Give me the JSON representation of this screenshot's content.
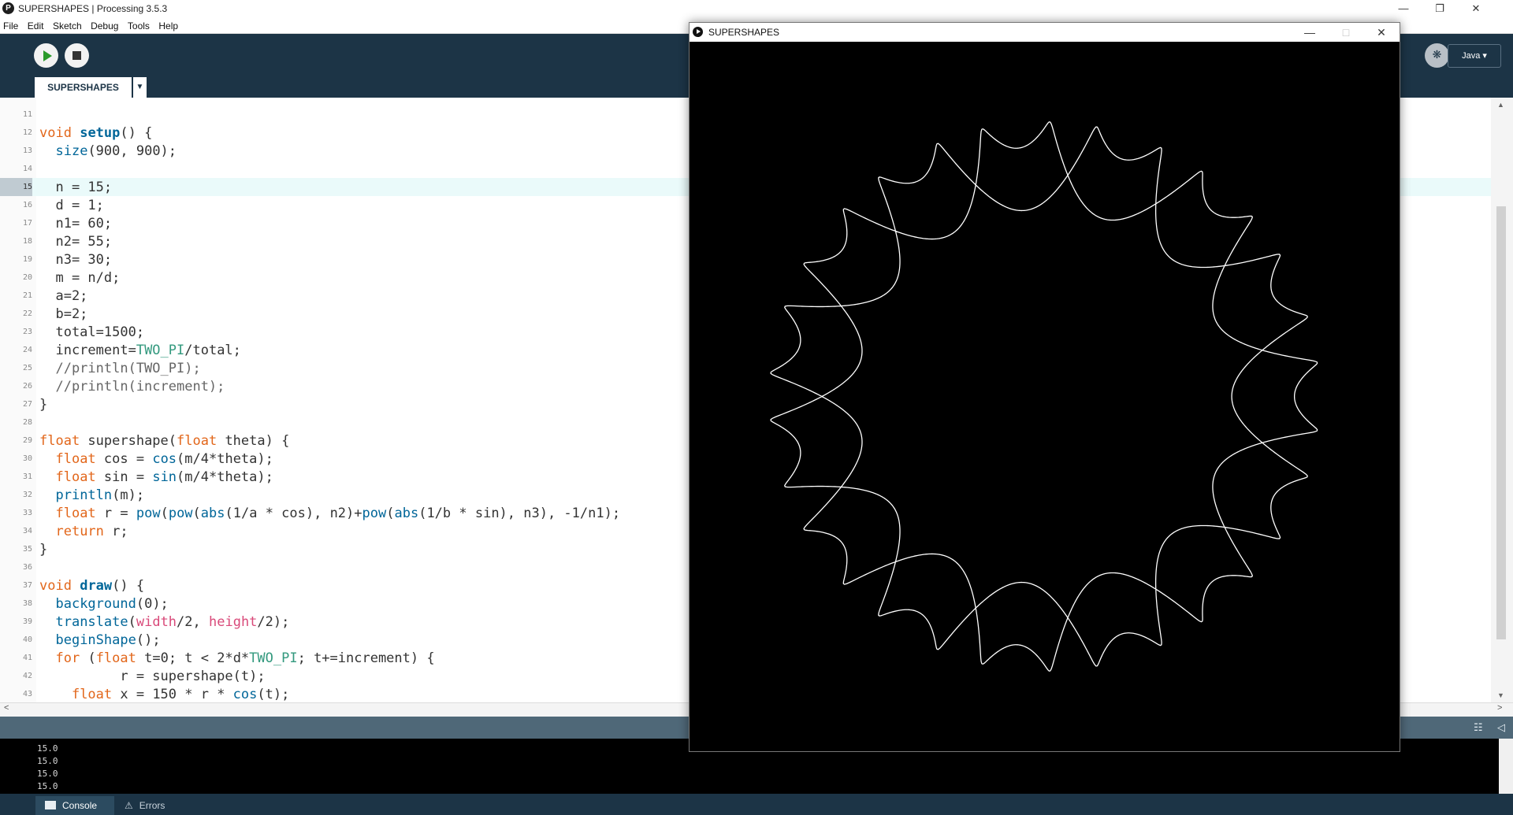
{
  "window": {
    "title": "SUPERSHAPES | Processing 3.5.3",
    "app_icon": "processing-logo-icon",
    "controls": [
      "minimize-icon",
      "restore-icon",
      "close-icon"
    ]
  },
  "menu": [
    "File",
    "Edit",
    "Sketch",
    "Debug",
    "Tools",
    "Help"
  ],
  "toolbar": {
    "run_icon": "play-icon",
    "stop_icon": "stop-icon",
    "debug_icon": "debugger-icon",
    "mode_label": "Java ▾"
  },
  "tab": {
    "label": "SUPERSHAPES",
    "menu_glyph": "▼"
  },
  "editor": {
    "current_line": 15,
    "lines": [
      {
        "n": "11"
      },
      {
        "n": "12"
      },
      {
        "n": "13"
      },
      {
        "n": "14"
      },
      {
        "n": "15"
      },
      {
        "n": "16"
      },
      {
        "n": "17"
      },
      {
        "n": "18"
      },
      {
        "n": "19"
      },
      {
        "n": "20"
      },
      {
        "n": "21"
      },
      {
        "n": "22"
      },
      {
        "n": "23"
      },
      {
        "n": "24"
      },
      {
        "n": "25"
      },
      {
        "n": "26"
      },
      {
        "n": "27"
      },
      {
        "n": "28"
      },
      {
        "n": "29"
      },
      {
        "n": "30"
      },
      {
        "n": "31"
      },
      {
        "n": "32"
      },
      {
        "n": "33"
      },
      {
        "n": "34"
      },
      {
        "n": "35"
      },
      {
        "n": "36"
      },
      {
        "n": "37"
      },
      {
        "n": "38"
      },
      {
        "n": "39"
      },
      {
        "n": "40"
      },
      {
        "n": "41"
      },
      {
        "n": "42"
      },
      {
        "n": "43"
      }
    ],
    "code": [
      "",
      "void setup() {",
      "  size(900, 900);",
      "",
      "  n = 15;",
      "  d = 1;",
      "  n1= 60;",
      "  n2= 55;",
      "  n3= 30;",
      "  m = n/d;",
      "  a=2;",
      "  b=2;",
      "  total=1500;",
      "  increment=TWO_PI/total;",
      "  //println(TWO_PI);",
      "  //println(increment);",
      "}",
      "",
      "float supershape(float theta) {",
      "  float cos = cos(m/4*theta);",
      "  float sin = sin(m/4*theta);",
      "  println(m);",
      "  float r = pow(pow(abs(1/a * cos), n2)+pow(abs(1/b * sin), n3), -1/n1);",
      "  return r;",
      "}",
      "",
      "void draw() {",
      "  background(0);",
      "  translate(width/2, height/2);",
      "  beginShape();",
      "  for (float t=0; t < 2*d*TWO_PI; t+=increment) {",
      "          r = supershape(t);",
      "    float x = 150 * r * cos(t);"
    ]
  },
  "console": {
    "lines": [
      "15.0",
      "15.0",
      "15.0",
      "15.0"
    ],
    "tabs": {
      "console": "Console",
      "errors": "Errors"
    }
  },
  "sketch_window": {
    "title": "SUPERSHAPES",
    "background": "#000000",
    "stroke": "#ffffff",
    "params": {
      "n": 15,
      "d": 1,
      "n1": 60,
      "n2": 55,
      "n3": 30,
      "a": 2,
      "b": 2,
      "total": 1500,
      "scale": 150
    }
  },
  "colors": {
    "toolbar": "#1c3446",
    "keyword": "#e2661a",
    "function": "#006699",
    "constant": "#33997e",
    "comment": "#666666"
  }
}
